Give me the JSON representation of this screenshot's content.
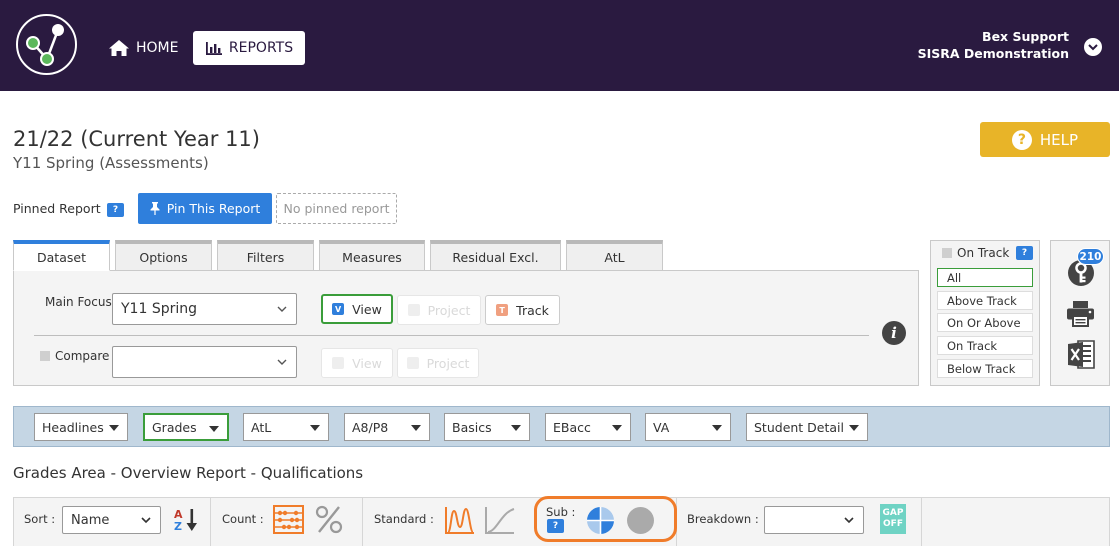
{
  "header": {
    "nav_home": "HOME",
    "nav_reports": "REPORTS",
    "user_name": "Bex Support",
    "organisation": "SISRA Demonstration",
    "bg_color": "#2a1a40"
  },
  "page": {
    "title": "21/22 (Current Year 11)",
    "subtitle": "Y11 Spring (Assessments)",
    "help_label": "HELP",
    "help_glyph": "?"
  },
  "pinned": {
    "label": "Pinned Report",
    "help_badge": "?",
    "pin_button": "Pin This Report",
    "no_pinned": "No pinned report"
  },
  "tabs": [
    {
      "label": "Dataset",
      "active": true
    },
    {
      "label": "Options"
    },
    {
      "label": "Filters"
    },
    {
      "label": "Measures"
    },
    {
      "label": "Residual Excl."
    },
    {
      "label": "AtL"
    }
  ],
  "dataset": {
    "main_focus_label": "Main Focus",
    "main_focus_value": "Y11 Spring",
    "compare_label": "Compare",
    "compare_value": "",
    "view_label": "View",
    "view_badge": "V",
    "project_label": "Project",
    "track_label": "Track",
    "track_badge": "T",
    "compare_view_label": "View",
    "compare_project_label": "Project",
    "info_glyph": "i"
  },
  "on_track": {
    "title": "On Track",
    "help_badge": "?",
    "options": [
      "All",
      "Above Track",
      "On Or Above",
      "On Track",
      "Below Track"
    ],
    "selected": "All"
  },
  "tools": {
    "key_count": "210"
  },
  "report_menus": [
    {
      "label": "Headlines"
    },
    {
      "label": "Grades",
      "selected": true
    },
    {
      "label": "AtL"
    },
    {
      "label": "A8/P8"
    },
    {
      "label": "Basics"
    },
    {
      "label": "EBacc"
    },
    {
      "label": "VA"
    },
    {
      "label": "Student Detail"
    }
  ],
  "section_title": "Grades Area - Overview Report - Qualifications",
  "toolbar": {
    "sort_label": "Sort :",
    "sort_value": "Name",
    "count_label": "Count :",
    "standard_label": "Standard :",
    "sub_label": "Sub :",
    "sub_help_badge": "?",
    "breakdown_label": "Breakdown :",
    "breakdown_value": "",
    "gap_line1": "GAP",
    "gap_line2": "OFF"
  },
  "colors": {
    "accent_blue": "#2f7fdc",
    "help_yellow": "#e8b428",
    "selected_green": "#3a9d3a",
    "chart_orange": "#f07c2a",
    "gap_teal": "#6fd3c4"
  }
}
